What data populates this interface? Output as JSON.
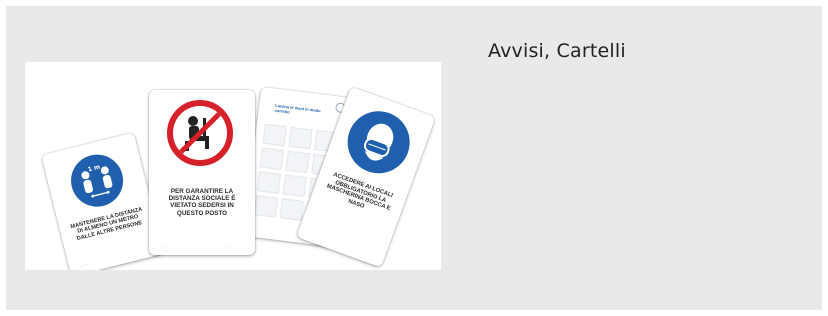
{
  "card": {
    "title": "Avvisi, Cartelli"
  },
  "signs": {
    "distance": {
      "label": "1 m",
      "text": "MANTENERE LA DISTANZA DI ALMENO UN METRO DALLE ALTRE PERSONE"
    },
    "no_sitting": {
      "text": "PER GARANTIRE LA DISTANZA SOCIALE È VIETATO SEDERSI IN QUESTO POSTO"
    },
    "handwash": {
      "title": "Lavarsi le mani in modo corretto"
    },
    "mask": {
      "text": "ACCEDERE AI LOCALI OBBLIGATORIO LA MASCHERINA BOCCA E NASO"
    }
  },
  "colors": {
    "card_bg": "#e9e9e9",
    "sign_blue": "#1f5fae",
    "prohibition_red": "#d6202a"
  }
}
